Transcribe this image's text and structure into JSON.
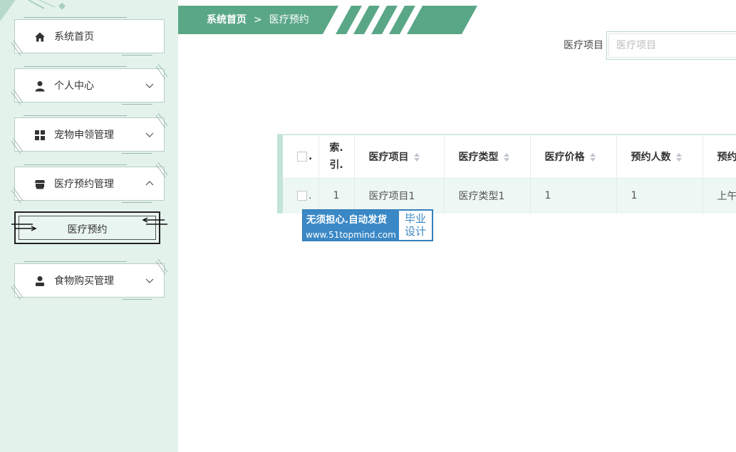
{
  "sidebar": {
    "items": [
      {
        "label": "系统首页",
        "icon": "home-icon",
        "chevron": ""
      },
      {
        "label": "个人中心",
        "icon": "person-icon",
        "chevron": "down"
      },
      {
        "label": "宠物申领管理",
        "icon": "grid-icon",
        "chevron": "down"
      },
      {
        "label": "医疗预约管理",
        "icon": "store-icon",
        "chevron": "up"
      },
      {
        "label": "食物购买管理",
        "icon": "user-badge-icon",
        "chevron": "down"
      }
    ],
    "subitem": {
      "label": "医疗预约"
    }
  },
  "breadcrumb": {
    "home": "系统首页",
    "separator": ">",
    "current": "医疗预约"
  },
  "search": {
    "label": "医疗项目",
    "placeholder": "医疗项目",
    "value": ""
  },
  "table": {
    "headers": [
      "索.引.",
      "医疗项目",
      "医疗类型",
      "医疗价格",
      "预约人数",
      "预约"
    ],
    "rows": [
      [
        "1",
        "医疗项目1",
        "医疗类型1",
        "1",
        "1",
        "上午"
      ]
    ]
  },
  "watermark": {
    "line1": "无须担心.自动发货",
    "line2": "www.51topmind.com",
    "box1": "毕业",
    "box2": "设计"
  },
  "colors": {
    "accent": "#5aa787",
    "sidebar_bg": "#e3f3ec",
    "row_bg": "#edf7f3",
    "watermark_blue": "#3a88c6"
  }
}
